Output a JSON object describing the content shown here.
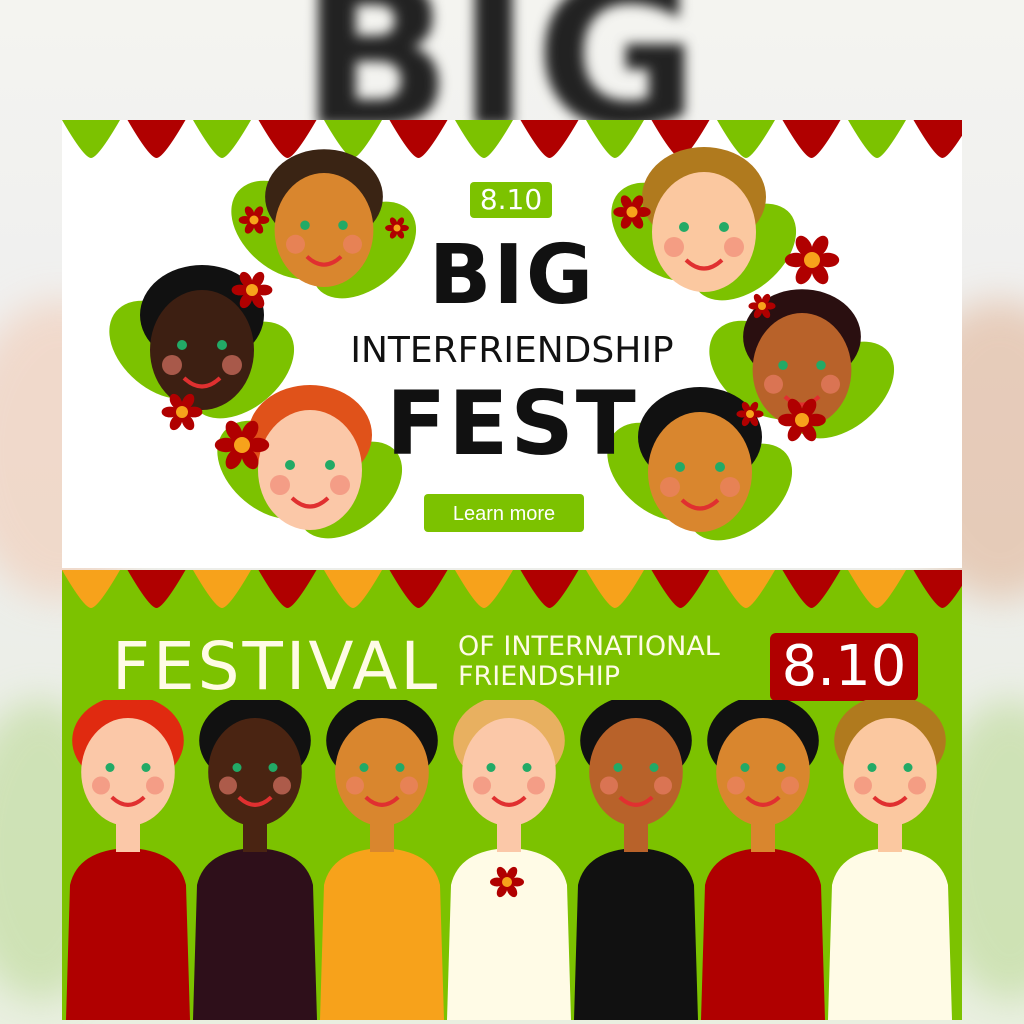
{
  "background": {
    "blurred_text": "BIG"
  },
  "top_banner": {
    "date": "8.10",
    "title_line1": "BIG",
    "title_line2": "INTERFRIENDSHIP",
    "title_line3": "FEST",
    "button_label": "Learn more",
    "bunting_colors": [
      "#7cc200",
      "#b00000"
    ],
    "faces": [
      {
        "skin": "#d9862e",
        "hair": "#3a2414"
      },
      {
        "skin": "#3d1f12",
        "hair": "#111111"
      },
      {
        "skin": "#fbc8a8",
        "hair": "#e0521a"
      },
      {
        "skin": "#fbc8a0",
        "hair": "#b07a1e"
      },
      {
        "skin": "#b8622a",
        "hair": "#2a0f10"
      },
      {
        "skin": "#d9862e",
        "hair": "#111111"
      }
    ]
  },
  "bottom_banner": {
    "title": "FESTIVAL",
    "subtitle_line1": "OF INTERNATIONAL",
    "subtitle_line2": "FRIENDSHIP",
    "date": "8.10",
    "bunting_colors": [
      "#f7a21b",
      "#b00000"
    ],
    "people": [
      {
        "skin": "#fbc8a8",
        "hair": "#e02a10",
        "shirt": "#b00000"
      },
      {
        "skin": "#4a2412",
        "hair": "#111111",
        "shirt": "#2e0f1a"
      },
      {
        "skin": "#d9862e",
        "hair": "#111111",
        "shirt": "#f7a21b"
      },
      {
        "skin": "#fbc8a8",
        "hair": "#e8b060",
        "shirt": "#fffbe6"
      },
      {
        "skin": "#b8622a",
        "hair": "#111111",
        "shirt": "#111111"
      },
      {
        "skin": "#d9862e",
        "hair": "#111111",
        "shirt": "#b00000"
      },
      {
        "skin": "#fbc8a0",
        "hair": "#b07a1e",
        "shirt": "#fffbe6"
      }
    ]
  },
  "colors": {
    "green": "#7cc200",
    "red": "#b00000",
    "orange": "#f7a21b",
    "cream": "#fffbe6"
  }
}
